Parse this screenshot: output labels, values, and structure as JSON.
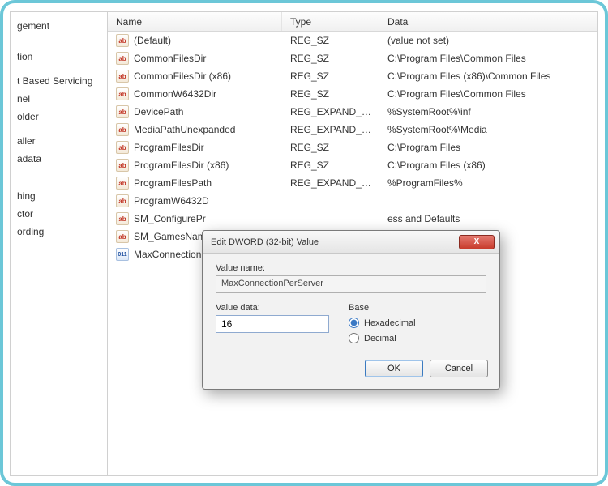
{
  "tree": {
    "items": [
      "gement",
      "",
      "",
      "tion",
      "",
      "t Based Servicing",
      "nel",
      "older",
      "",
      "aller",
      "adata",
      "",
      "",
      "",
      "hing",
      "ctor",
      "ording"
    ]
  },
  "list": {
    "headers": {
      "name": "Name",
      "type": "Type",
      "data": "Data"
    },
    "rows": [
      {
        "icon": "str",
        "name": "(Default)",
        "type": "REG_SZ",
        "data": "(value not set)"
      },
      {
        "icon": "str",
        "name": "CommonFilesDir",
        "type": "REG_SZ",
        "data": "C:\\Program Files\\Common Files"
      },
      {
        "icon": "str",
        "name": "CommonFilesDir (x86)",
        "type": "REG_SZ",
        "data": "C:\\Program Files (x86)\\Common Files"
      },
      {
        "icon": "str",
        "name": "CommonW6432Dir",
        "type": "REG_SZ",
        "data": "C:\\Program Files\\Common Files"
      },
      {
        "icon": "str",
        "name": "DevicePath",
        "type": "REG_EXPAND_SZ",
        "data": "%SystemRoot%\\inf"
      },
      {
        "icon": "str",
        "name": "MediaPathUnexpanded",
        "type": "REG_EXPAND_SZ",
        "data": "%SystemRoot%\\Media"
      },
      {
        "icon": "str",
        "name": "ProgramFilesDir",
        "type": "REG_SZ",
        "data": "C:\\Program Files"
      },
      {
        "icon": "str",
        "name": "ProgramFilesDir (x86)",
        "type": "REG_SZ",
        "data": "C:\\Program Files (x86)"
      },
      {
        "icon": "str",
        "name": "ProgramFilesPath",
        "type": "REG_EXPAND_SZ",
        "data": "%ProgramFiles%"
      },
      {
        "icon": "str",
        "name": "ProgramW6432D",
        "type": "",
        "data": ""
      },
      {
        "icon": "str",
        "name": "SM_ConfigurePr",
        "type": "",
        "data": "ess and Defaults"
      },
      {
        "icon": "str",
        "name": "SM_GamesName",
        "type": "",
        "data": ""
      },
      {
        "icon": "bin",
        "name": "MaxConnection",
        "type": "",
        "data": ""
      }
    ]
  },
  "dialog": {
    "title": "Edit DWORD (32-bit) Value",
    "valueName_label": "Value name:",
    "valueName": "MaxConnectionPerServer",
    "valueData_label": "Value data:",
    "valueData": "16",
    "base_label": "Base",
    "hex_label": "Hexadecimal",
    "dec_label": "Decimal",
    "ok": "OK",
    "cancel": "Cancel",
    "close_x": "X"
  }
}
